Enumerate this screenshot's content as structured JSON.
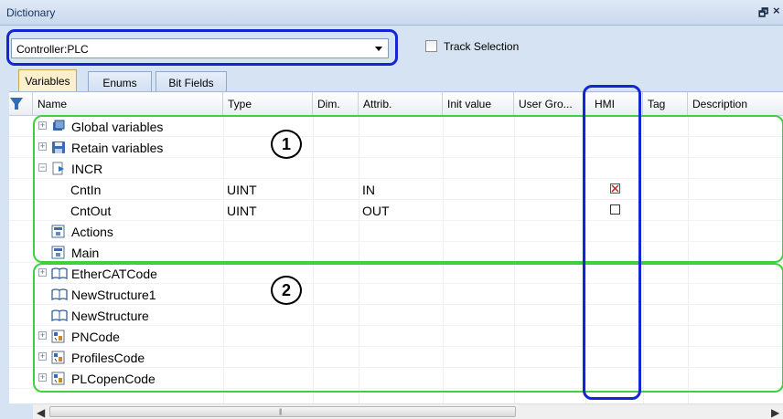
{
  "window": {
    "title": "Dictionary",
    "pin_glyph": "🗗",
    "close_glyph": "×"
  },
  "toolbar": {
    "controller_value": "Controller:PLC",
    "track_selection_label": "Track Selection",
    "track_selection_checked": false
  },
  "tabs": [
    {
      "label": "Variables",
      "active": true
    },
    {
      "label": "Enums",
      "active": false
    },
    {
      "label": "Bit Fields",
      "active": false
    }
  ],
  "columns": [
    "Name",
    "Type",
    "Dim.",
    "Attrib.",
    "Init value",
    "User Gro...",
    "HMI",
    "Tag",
    "Description"
  ],
  "rows": [
    {
      "name": "Global variables",
      "icon": "global-vars-icon",
      "expander": "+",
      "type": "",
      "attrib": "",
      "hmi": ""
    },
    {
      "name": "Retain variables",
      "icon": "retain-vars-icon",
      "expander": "+",
      "type": "",
      "attrib": "",
      "hmi": ""
    },
    {
      "name": "INCR",
      "icon": "program-icon",
      "expander": "−",
      "type": "",
      "attrib": "",
      "hmi": ""
    },
    {
      "name": "CntIn",
      "icon": "",
      "expander": "",
      "type": "UINT",
      "attrib": "IN",
      "hmi": "checked"
    },
    {
      "name": "CntOut",
      "icon": "",
      "expander": "",
      "type": "UINT",
      "attrib": "OUT",
      "hmi": "unchecked"
    },
    {
      "name": "Actions",
      "icon": "actions-icon",
      "expander": "",
      "type": "",
      "attrib": "",
      "hmi": ""
    },
    {
      "name": "Main",
      "icon": "main-icon",
      "expander": "",
      "type": "",
      "attrib": "",
      "hmi": ""
    },
    {
      "name": "EtherCATCode",
      "icon": "book-icon",
      "expander": "+",
      "type": "",
      "attrib": "",
      "hmi": ""
    },
    {
      "name": "NewStructure1",
      "icon": "book-icon",
      "expander": "",
      "type": "",
      "attrib": "",
      "hmi": ""
    },
    {
      "name": "NewStructure",
      "icon": "book-icon",
      "expander": "",
      "type": "",
      "attrib": "",
      "hmi": ""
    },
    {
      "name": "PNCode",
      "icon": "library-icon",
      "expander": "+",
      "type": "",
      "attrib": "",
      "hmi": ""
    },
    {
      "name": "ProfilesCode",
      "icon": "library-icon",
      "expander": "+",
      "type": "",
      "attrib": "",
      "hmi": ""
    },
    {
      "name": "PLCopenCode",
      "icon": "library-icon",
      "expander": "+",
      "type": "",
      "attrib": "",
      "hmi": ""
    }
  ],
  "annotations": {
    "group1_label": "1",
    "group2_label": "2"
  },
  "colors": {
    "highlight_blue": "#1426d4",
    "group_green": "#3ed13e",
    "hmi_check_red": "#d02020"
  }
}
